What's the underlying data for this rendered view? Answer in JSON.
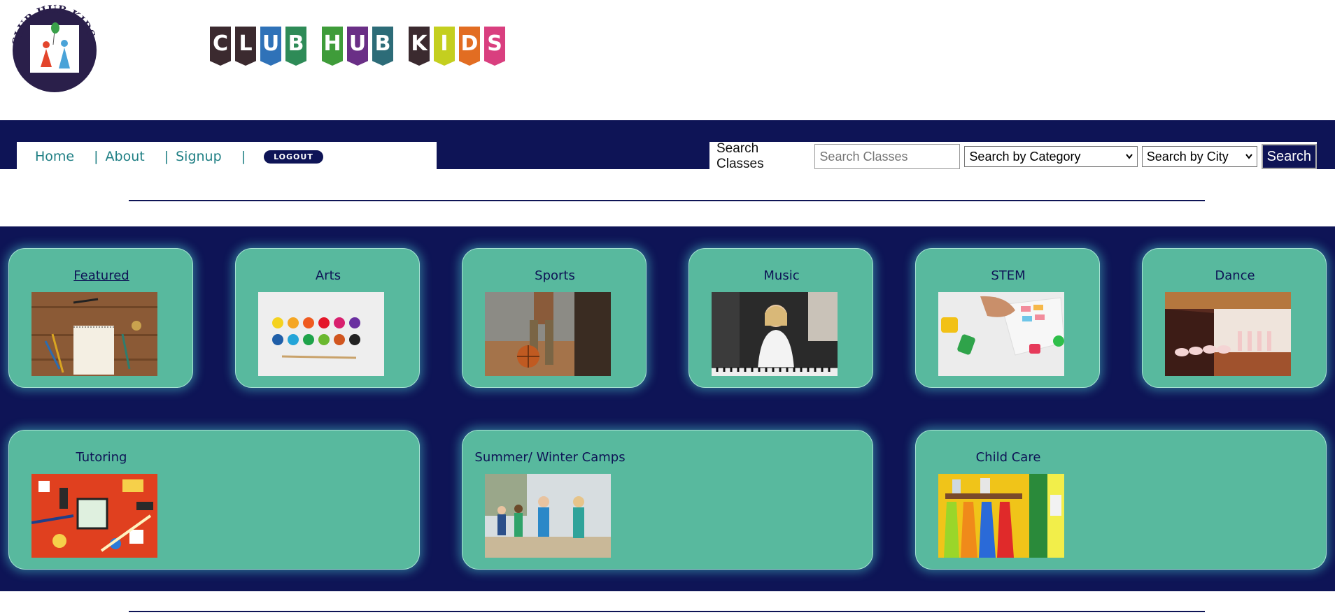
{
  "header": {
    "badge_text": "CLUB HUB KIDS",
    "brand_banner_letters": [
      [
        {
          "letter": "C",
          "color": "#3b2a2f"
        },
        {
          "letter": "L",
          "color": "#3b2a2f"
        },
        {
          "letter": "U",
          "color": "#2f72b8"
        },
        {
          "letter": "B",
          "color": "#2e8b57"
        }
      ],
      [
        {
          "letter": "H",
          "color": "#3f9c3a"
        },
        {
          "letter": "U",
          "color": "#6a2f86"
        },
        {
          "letter": "B",
          "color": "#2d6c78"
        }
      ],
      [
        {
          "letter": "K",
          "color": "#3b2a2f"
        },
        {
          "letter": "I",
          "color": "#c4cf1f"
        },
        {
          "letter": "D",
          "color": "#e26d22"
        },
        {
          "letter": "S",
          "color": "#d93f7f"
        }
      ]
    ]
  },
  "nav": {
    "items": [
      {
        "label": "Home"
      },
      {
        "label": "About"
      },
      {
        "label": "Signup"
      }
    ],
    "separator": "|",
    "logout_label": "LOGOUT"
  },
  "search": {
    "label": "Search Classes",
    "input_placeholder": "Search Classes",
    "category_select": "Search by Category",
    "city_select": "Search by City",
    "button_label": "Search"
  },
  "categories": [
    {
      "title": "Featured",
      "image": "notepad-and-pencils-photo"
    },
    {
      "title": "Arts",
      "image": "watercolor-paint-set-photo"
    },
    {
      "title": "Sports",
      "image": "child-with-basketball-photo"
    },
    {
      "title": "Music",
      "image": "girl-playing-piano-photo"
    },
    {
      "title": "STEM",
      "image": "kid-with-coding-toys-photo"
    },
    {
      "title": "Dance",
      "image": "ballet-class-stage-photo"
    },
    {
      "title": "Tutoring",
      "image": "school-supplies-flatlay-photo"
    },
    {
      "title": "Summer/ Winter Camps",
      "image": "kids-walking-on-beach-photo"
    },
    {
      "title": "Child Care",
      "image": "daycare-cubby-wall-photo"
    }
  ],
  "colors": {
    "navy": "#0e1456",
    "card_green": "#58b99e",
    "link_teal": "#1f7f84"
  }
}
